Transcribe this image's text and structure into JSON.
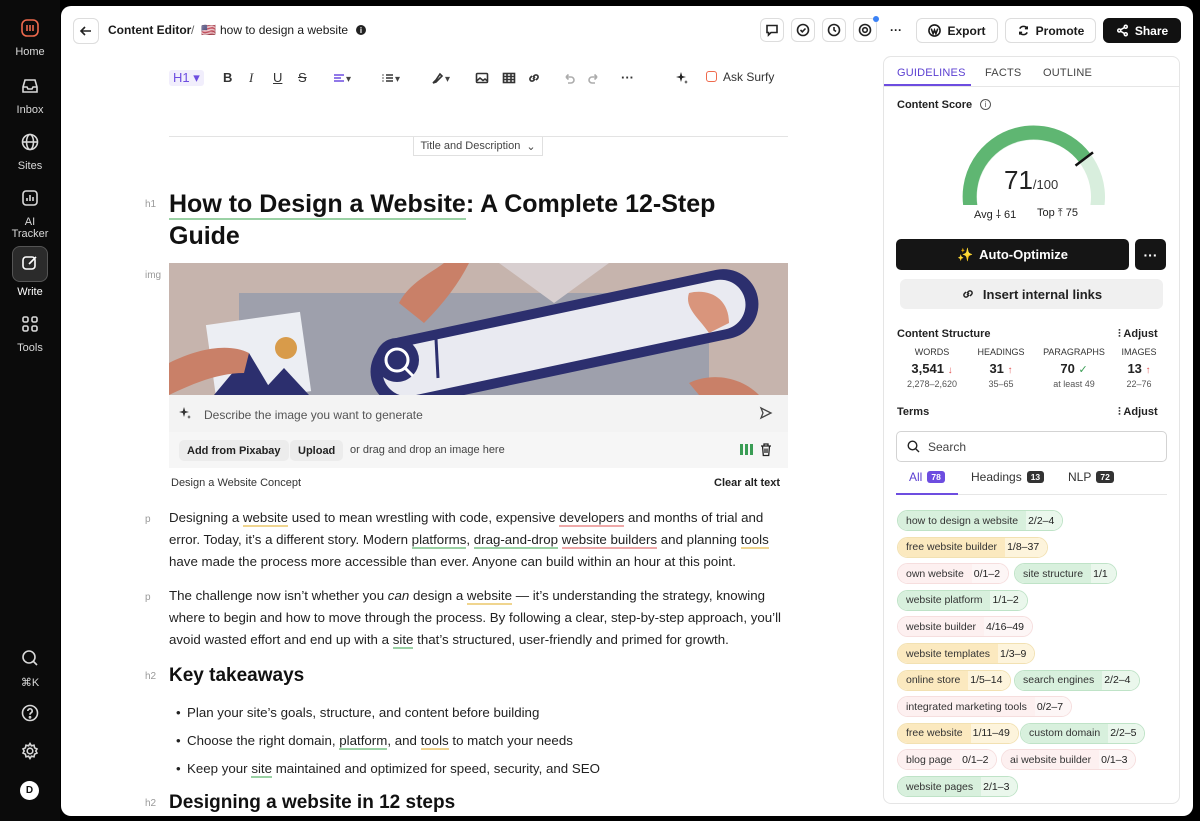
{
  "rail": {
    "items": [
      {
        "label": "Home"
      },
      {
        "label": "Inbox"
      },
      {
        "label": "Sites"
      },
      {
        "label": "AI Tracker"
      },
      {
        "label": "Write"
      },
      {
        "label": "Tools"
      }
    ],
    "shortcut": "⌘K",
    "avatar_initial": "D"
  },
  "header": {
    "section": "Content Editor",
    "separator": "/",
    "flag": "🇺🇸",
    "doc_title": "how to design a website",
    "buttons": {
      "export": "Export",
      "promote": "Promote",
      "share": "Share"
    },
    "more": "···"
  },
  "toolbar": {
    "heading": "H1",
    "ask": "Ask Surfy"
  },
  "editor": {
    "title_desc_toggle": "Title and Description",
    "tags": {
      "h1": "h1",
      "img": "img",
      "p": "p",
      "h2": "h2"
    },
    "h1_before": "How to Design a Website",
    "h1_after": ": A Complete 12-Step Guide",
    "image_prompt_placeholder": "Describe the image you want to generate",
    "add_pixabay": "Add from Pixabay",
    "upload": "Upload",
    "drag_drop": "or drag and drop an image here",
    "caption": "Design a Website Concept",
    "clear_alt": "Clear alt text",
    "p1": {
      "a": "Designing a ",
      "b": "website",
      "c": " used to mean wrestling with code, expensive ",
      "d": "developers",
      "e": " and months of trial and error. Today, it’s a different story. Modern ",
      "f": "platforms",
      "g": ", ",
      "h": "drag-and-drop",
      "i": " ",
      "j": "website builders",
      "k": " and planning ",
      "l": "tools",
      "m": " have made the process more accessible than ever. Anyone can build within an hour at this point."
    },
    "p2": {
      "a": "The challenge now isn’t whether you ",
      "em": "can",
      "b": " design a ",
      "c": "website",
      "d": " — it’s understanding the strategy, knowing where to begin and how to move through the process. By following a clear, step-by-step approach, you’ll avoid wasted effort and end up with a ",
      "e": "site",
      "f": " that’s structured, user-friendly and primed for growth."
    },
    "h2_takeaways": "Key takeaways",
    "bullets": {
      "b1": "Plan your site’s goals, structure, and content before building",
      "b2a": "Choose the right domain, ",
      "b2b": "platform",
      "b2c": ", and ",
      "b2d": "tools",
      "b2e": " to match your needs",
      "b3a": "Keep your ",
      "b3b": "site",
      "b3c": " maintained and optimized for speed, security, and SEO"
    },
    "h2_next": "Designing a website in 12 steps"
  },
  "panel": {
    "tabs": [
      "GUIDELINES",
      "FACTS",
      "OUTLINE"
    ],
    "content_score_label": "Content Score",
    "score": "71",
    "score_max": "/100",
    "score_value": 71,
    "avg_label": "Avg",
    "avg": "61",
    "top_label": "Top",
    "top": "75",
    "auto_optimize": "Auto-Optimize",
    "insert_links": "Insert internal links",
    "structure_label": "Content Structure",
    "adjust": "Adjust",
    "stats": [
      {
        "k": "WORDS",
        "v": "3,541",
        "arrow": "↓",
        "r": "2,278–2,620"
      },
      {
        "k": "HEADINGS",
        "v": "31",
        "arrow": "↑",
        "r": "35–65"
      },
      {
        "k": "PARAGRAPHS",
        "v": "70",
        "arrow": "✓",
        "r": "at least 49"
      },
      {
        "k": "IMAGES",
        "v": "13",
        "arrow": "↑",
        "r": "22–76"
      }
    ],
    "terms_label": "Terms",
    "search_placeholder": "Search",
    "term_tabs": [
      {
        "label": "All",
        "count": "78"
      },
      {
        "label": "Headings",
        "count": "13"
      },
      {
        "label": "NLP",
        "count": "72"
      }
    ],
    "terms": [
      {
        "name": "how to design a website",
        "count": "2/2–4",
        "status": "green"
      },
      {
        "name": "free website builder",
        "count": "1/8–37",
        "status": "yellow"
      },
      {
        "name": "own website",
        "count": "0/1–2",
        "status": "red"
      },
      {
        "name": "site structure",
        "count": "1/1",
        "status": "green"
      },
      {
        "name": "website platform",
        "count": "1/1–2",
        "status": "green"
      },
      {
        "name": "website builder",
        "count": "4/16–49",
        "status": "red"
      },
      {
        "name": "website templates",
        "count": "1/3–9",
        "status": "yellow"
      },
      {
        "name": "online store",
        "count": "1/5–14",
        "status": "yellow"
      },
      {
        "name": "search engines",
        "count": "2/2–4",
        "status": "green"
      },
      {
        "name": "integrated marketing tools",
        "count": "0/2–7",
        "status": "red"
      },
      {
        "name": "free website",
        "count": "1/11–49",
        "status": "yellow"
      },
      {
        "name": "custom domain",
        "count": "2/2–5",
        "status": "green"
      },
      {
        "name": "blog page",
        "count": "0/1–2",
        "status": "red"
      },
      {
        "name": "ai website builder",
        "count": "0/1–3",
        "status": "red"
      },
      {
        "name": "website pages",
        "count": "2/1–3",
        "status": "green"
      }
    ]
  }
}
